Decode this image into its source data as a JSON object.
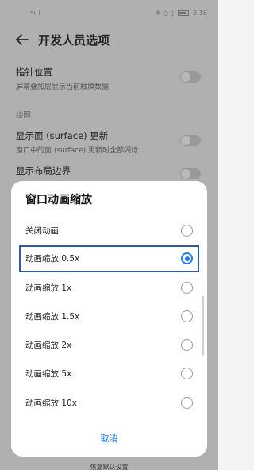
{
  "status_bar": {
    "signal": "⁴ııl",
    "right_icons": "✲ ◷ ▯",
    "time": "2:16"
  },
  "header": {
    "title": "开发人员选项"
  },
  "background_settings": {
    "pointer_location": {
      "title": "指针位置",
      "subtitle": "屏幕叠加层显示当前触摸数据"
    },
    "section_drawing": "绘图",
    "surface_updates": {
      "title": "显示面 (surface) 更新",
      "subtitle": "窗口中的面 (surface) 更新时全部闪烁"
    },
    "layout_bounds": {
      "title": "显示布局边界"
    },
    "bottom_peek": "恢复默认设置"
  },
  "dialog": {
    "title": "窗口动画缩放",
    "options": [
      {
        "label": "关闭动画",
        "selected": false
      },
      {
        "label": "动画缩放 0.5x",
        "selected": true
      },
      {
        "label": "动画缩放 1x",
        "selected": false
      },
      {
        "label": "动画缩放 1.5x",
        "selected": false
      },
      {
        "label": "动画缩放 2x",
        "selected": false
      },
      {
        "label": "动画缩放 5x",
        "selected": false
      },
      {
        "label": "动画缩放 10x",
        "selected": false
      }
    ],
    "cancel_label": "取消"
  },
  "colors": {
    "accent": "#1a7cf0",
    "highlight_box": "#2f5aa8"
  }
}
